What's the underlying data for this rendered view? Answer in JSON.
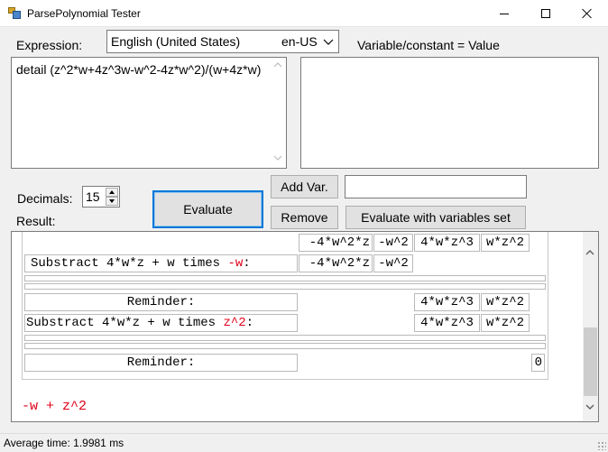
{
  "window": {
    "title": "ParsePolynomial Tester"
  },
  "labels": {
    "expression": "Expression:",
    "variable_header": "Variable/constant  = Value",
    "decimals": "Decimals:",
    "result": "Result:"
  },
  "culture": {
    "language": "English (United States)",
    "code": "en-US"
  },
  "expression": {
    "value": "detail (z^2*w+4z^3w-w^2-4z*w^2)/(w+4z*w)"
  },
  "decimals": {
    "value": "15"
  },
  "buttons": {
    "evaluate": "Evaluate",
    "add_var": "Add Var.",
    "remove": "Remove",
    "evaluate_with_vars": "Evaluate with variables set"
  },
  "variable_input": {
    "value": ""
  },
  "result": {
    "row1": {
      "c1": "-4*w^2*z",
      "c2": "-w^2",
      "c3": "4*w*z^3",
      "c4": "w*z^2"
    },
    "row2": {
      "prefix": "Substract 4*w*z + w times ",
      "term": "-w",
      "suffix": ":",
      "c1": "-4*w^2*z",
      "c2": "-w^2"
    },
    "row3": {
      "label": "Reminder:",
      "c3": "4*w*z^3",
      "c4": "w*z^2"
    },
    "row4": {
      "prefix": "Substract 4*w*z + w times ",
      "term": "z^2",
      "suffix": ":",
      "c3": "4*w*z^3",
      "c4": "w*z^2"
    },
    "row5": {
      "label": "Reminder:",
      "value": "0"
    },
    "final": "-w + z^2"
  },
  "status": {
    "text": "Average time: 1.9981 ms"
  },
  "colors": {
    "accent": "#0078d7",
    "result_red": "#e0001b"
  }
}
